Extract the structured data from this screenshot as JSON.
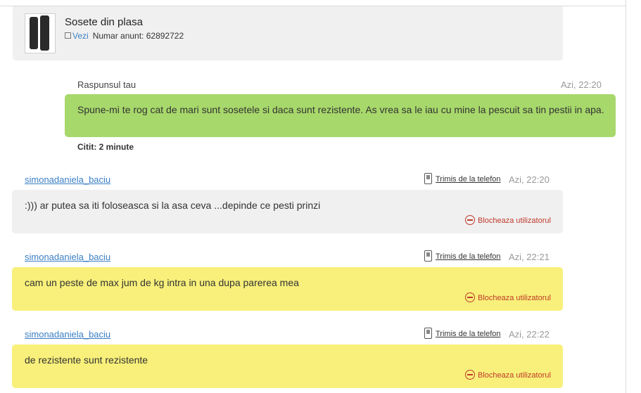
{
  "listing": {
    "title": "Sosete din plasa",
    "view_link": "Vezi",
    "ad_number": "Numar anunt: 62892722"
  },
  "reply": {
    "label": "Raspunsul tau",
    "time": "Azi, 22:20",
    "text": "Spune-mi te rog cat de mari sunt sosetele si daca sunt rezistente. As vrea sa le iau cu mine la pescuit sa tin pestii in apa.",
    "read_status": "Citit: 2 minute"
  },
  "messages": [
    {
      "user": "simonadaniela_baciu",
      "via": "Trimis de la telefon",
      "time": "Azi, 22:20",
      "text": ":))) ar putea sa iti foloseasca si la asa ceva ...depinde ce pesti prinzi",
      "block_label": "Blocheaza utilizatorul"
    },
    {
      "user": "simonadaniela_baciu",
      "via": "Trimis de la telefon",
      "time": "Azi, 22:21",
      "text": "cam un peste de max jum de kg intra in una dupa parerea mea",
      "block_label": "Blocheaza utilizatorul"
    },
    {
      "user": "simonadaniela_baciu",
      "via": "Trimis de la telefon",
      "time": "Azi, 22:22",
      "text": "de rezistente sunt rezistente",
      "block_label": "Blocheaza utilizatorul"
    }
  ],
  "colors": {
    "reply_bubble": "#a7d86b",
    "received_grey": "#f0f0f0",
    "received_yellow": "#f8f07a",
    "link": "#3b7fc4",
    "block_red": "#c0392b"
  }
}
